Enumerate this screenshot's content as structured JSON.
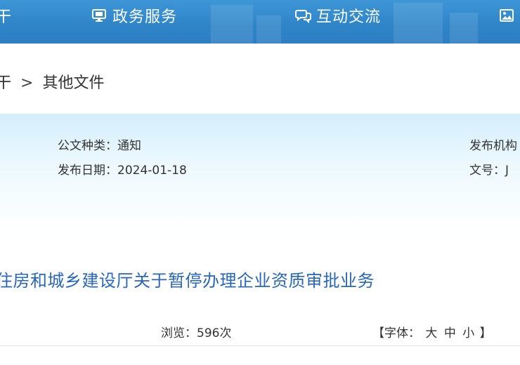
{
  "nav": {
    "left_cut_label": "干",
    "gov_service": "政务服务",
    "interaction": "互动交流",
    "more_cut_label": ""
  },
  "breadcrumb": {
    "prev_cut": "干",
    "separator": ">",
    "current": "其他文件"
  },
  "info": {
    "doc_type_label": "公文种类：",
    "doc_type_value": "通知",
    "publish_date_label": "发布日期：",
    "publish_date_value": "2024-01-18",
    "issuer_label": "发布机构",
    "doc_no_label": "文号：",
    "doc_no_value": "J"
  },
  "title": "住房和城乡建设厅关于暂停办理企业资质审批业务",
  "meta": {
    "views_label": "浏览：",
    "views_count": "596",
    "views_unit": "次",
    "font_open": "【字体：",
    "font_large": "大",
    "font_medium": "中",
    "font_small": "小",
    "font_close": "】"
  },
  "colors": {
    "nav_bg": "#3d96d6",
    "title_color": "#2a66b8"
  }
}
